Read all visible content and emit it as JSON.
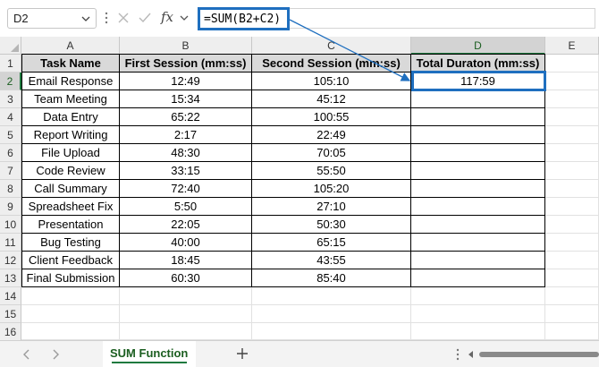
{
  "formula_bar": {
    "name_box": "D2",
    "fx_label": "fx",
    "formula": "=SUM(B2+C2)"
  },
  "columns": [
    "A",
    "B",
    "C",
    "D",
    "E"
  ],
  "rows": [
    "1",
    "2",
    "3",
    "4",
    "5",
    "6",
    "7",
    "8",
    "9",
    "10",
    "11",
    "12",
    "13",
    "14",
    "15",
    "16"
  ],
  "table": {
    "headers": [
      "Task Name",
      "First Session (mm:ss)",
      "Second Session (mm:ss)",
      "Total Duraton (mm:ss)"
    ],
    "rows": [
      [
        "Email Response",
        "12:49",
        "105:10",
        "117:59"
      ],
      [
        "Team Meeting",
        "15:34",
        "45:12",
        ""
      ],
      [
        "Data Entry",
        "65:22",
        "100:55",
        ""
      ],
      [
        "Report Writing",
        "2:17",
        "22:49",
        ""
      ],
      [
        "File Upload",
        "48:30",
        "70:05",
        ""
      ],
      [
        "Code Review",
        "33:15",
        "55:50",
        ""
      ],
      [
        "Call Summary",
        "72:40",
        "105:20",
        ""
      ],
      [
        "Spreadsheet Fix",
        "5:50",
        "27:10",
        ""
      ],
      [
        "Presentation",
        "22:05",
        "50:30",
        ""
      ],
      [
        "Bug Testing",
        "40:00",
        "65:15",
        ""
      ],
      [
        "Client Feedback",
        "18:45",
        "43:55",
        ""
      ],
      [
        "Final Submission",
        "60:30",
        "85:40",
        ""
      ]
    ]
  },
  "selection": {
    "active_cell": "D2",
    "active_column": "D",
    "active_row": "2"
  },
  "sheet_tabs": [
    {
      "label": "SUM Function",
      "active": true
    }
  ],
  "colors": {
    "accent_blue": "#1f6fbf",
    "excel_green": "#1f7a3f",
    "header_fill": "#d9d9d9"
  }
}
